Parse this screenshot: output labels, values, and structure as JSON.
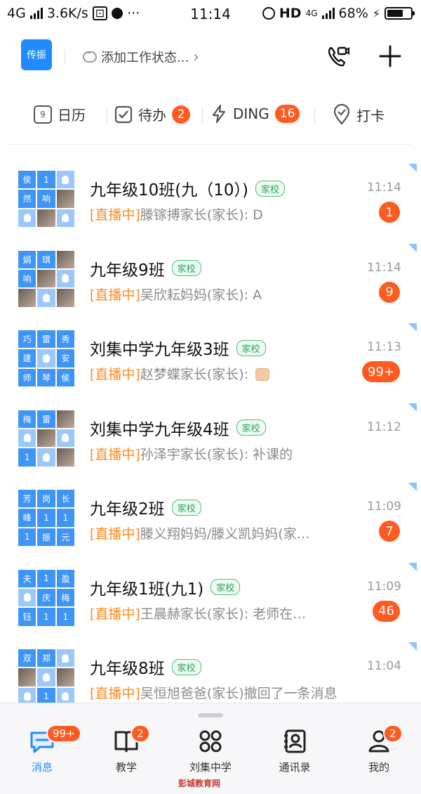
{
  "status_bar": {
    "network": "4G",
    "speed": "3.6K/s",
    "time": "11:14",
    "hd": "HD",
    "network_right": "4G",
    "battery": "68%"
  },
  "header": {
    "org_badge": "传振",
    "status_prompt": "添加工作状态...",
    "chevron": "›"
  },
  "quick_bar": {
    "calendar_label": "日历",
    "calendar_day": "9",
    "todo_label": "待办",
    "todo_count": "2",
    "ding_label": "DING",
    "ding_count": "16",
    "checkin_label": "打卡"
  },
  "conversations": [
    {
      "title": "九年级10班(九（10）)",
      "tag": "家校",
      "time": "11:14",
      "live": "[直播中]",
      "preview": "滕镓搏家长(家长): D",
      "badge": "1",
      "avatar": [
        "侯",
        "1",
        "",
        "然",
        "响",
        "",
        "",
        "",
        ""
      ]
    },
    {
      "title": "九年级9班",
      "tag": "家校",
      "time": "11:14",
      "live": "[直播中]",
      "preview": "吴欣耘妈妈(家长): A",
      "badge": "9",
      "avatar": [
        "娟",
        "琪",
        "",
        "响",
        "",
        "",
        "",
        "",
        ""
      ]
    },
    {
      "title": "刘集中学九年级3班",
      "tag": "家校",
      "time": "11:13",
      "live": "[直播中]",
      "preview": "赵梦蝶家长(家长): ",
      "badge": "99+",
      "avatar": [
        "巧",
        "雷",
        "秀",
        "建",
        "",
        "安",
        "师",
        "琴",
        "侯"
      ]
    },
    {
      "title": "刘集中学九年级4班",
      "tag": "家校",
      "time": "11:12",
      "live": "[直播中]",
      "preview": "孙泽宇家长(家长): 补课的",
      "badge": "",
      "avatar": [
        "梅",
        "雷",
        "",
        "",
        "",
        "",
        "1",
        "",
        ""
      ]
    },
    {
      "title": "九年级2班",
      "tag": "家校",
      "time": "11:09",
      "live": "[直播中]",
      "preview": "滕义翔妈妈/滕义凯妈妈(家…",
      "badge": "7",
      "avatar": [
        "芳",
        "岗",
        "长",
        "峰",
        "1",
        "1",
        "1",
        "振",
        "元"
      ]
    },
    {
      "title": "九年级1班(九1)",
      "tag": "家校",
      "time": "11:09",
      "live": "[直播中]",
      "preview": "王晨赫家长(家长): 老师在…",
      "badge": "46",
      "avatar": [
        "夫",
        "1",
        "盈",
        "",
        "庆",
        "梅",
        "钰",
        "1",
        "1"
      ]
    },
    {
      "title": "九年级8班",
      "tag": "家校",
      "time": "11:04",
      "live": "[直播中]",
      "preview": "吴恒旭爸爸(家长)撤回了一条消息",
      "badge": "",
      "avatar": [
        "双",
        "郑",
        "",
        "",
        "",
        "",
        "",
        "1",
        ""
      ]
    }
  ],
  "tab_bar": {
    "tabs": [
      {
        "label": "消息",
        "badge": "99+",
        "icon": "chat-icon"
      },
      {
        "label": "教学",
        "badge": "2",
        "icon": "book-icon"
      },
      {
        "label": "刘集中学",
        "badge": "",
        "icon": "grid-icon"
      },
      {
        "label": "通讯录",
        "badge": "",
        "icon": "contacts-icon"
      },
      {
        "label": "我的",
        "badge": "2",
        "icon": "person-icon"
      }
    ]
  },
  "watermark": "彭城教育网",
  "colors": {
    "accent": "#1f8bff",
    "badge": "#ff5a1f",
    "live": "#ff8a1f",
    "tag": "#2ba35d"
  }
}
